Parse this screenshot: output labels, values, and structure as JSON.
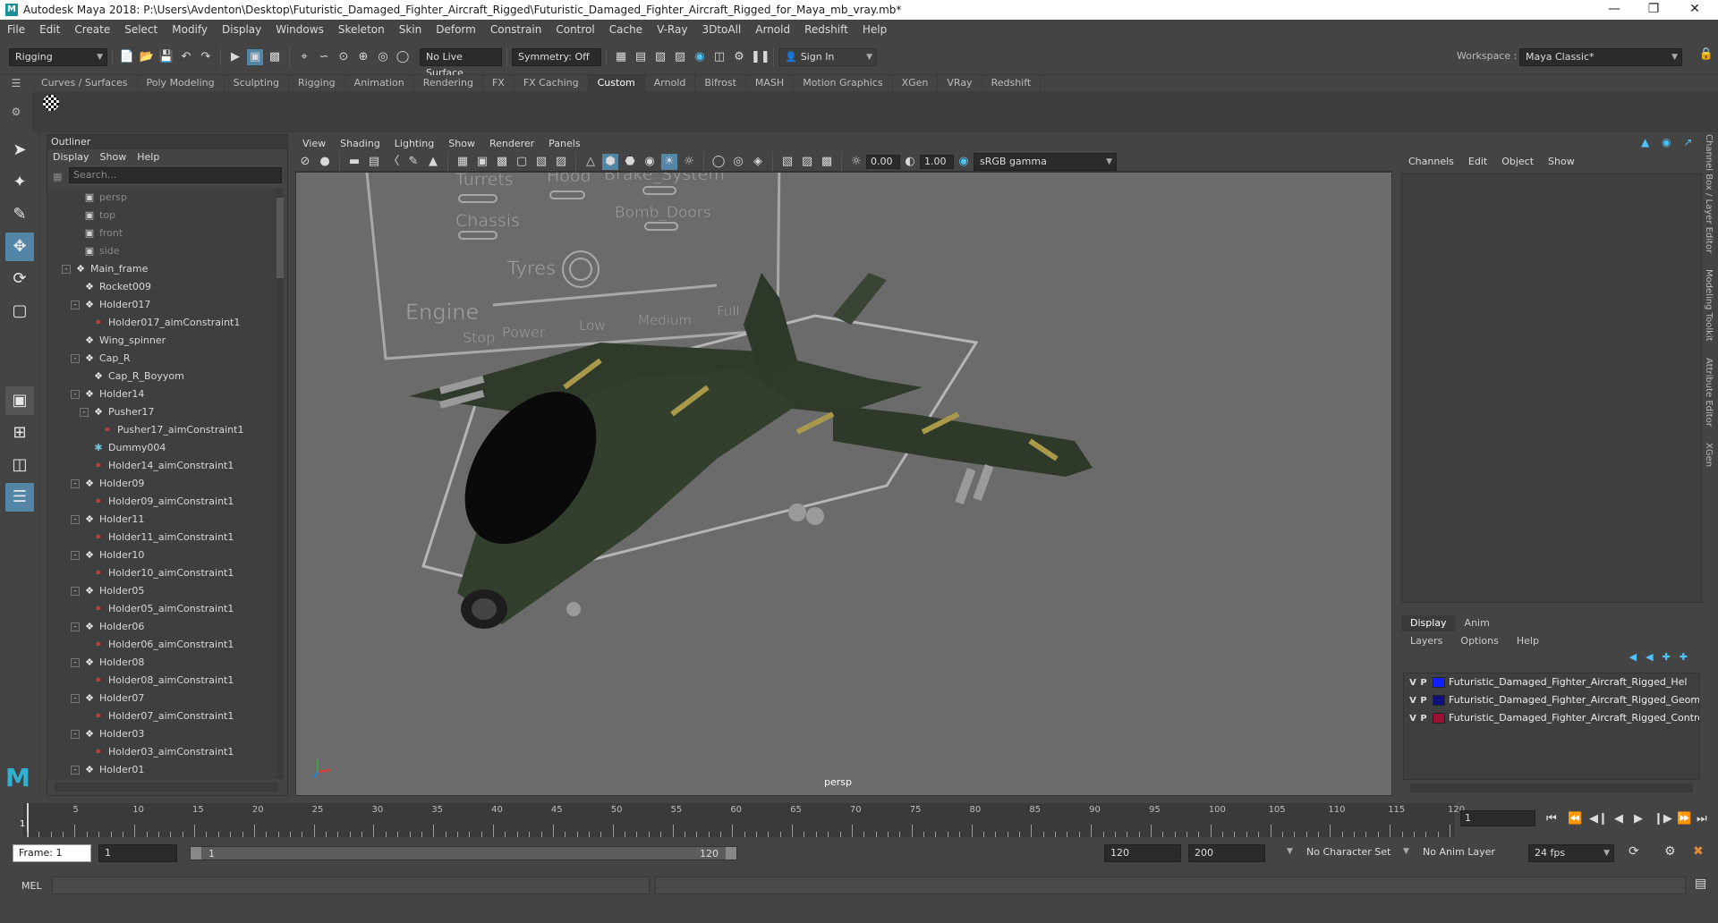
{
  "title": "Autodesk Maya 2018: P:\\Users\\Avdenton\\Desktop\\Futuristic_Damaged_Fighter_Aircraft_Rigged\\Futuristic_Damaged_Fighter_Aircraft_Rigged_for_Maya_mb_vray.mb*",
  "menu": [
    "File",
    "Edit",
    "Create",
    "Select",
    "Modify",
    "Display",
    "Windows",
    "Skeleton",
    "Skin",
    "Deform",
    "Constrain",
    "Control",
    "Cache",
    "V-Ray",
    "3DtoAll",
    "Arnold",
    "Redshift",
    "Help"
  ],
  "status": {
    "mode": "Rigging",
    "live_surface": "No Live Surface",
    "symmetry": "Symmetry: Off",
    "sign_in": "Sign In",
    "workspace_label": "Workspace :",
    "workspace_value": "Maya Classic*"
  },
  "shelf_tabs": [
    "Curves / Surfaces",
    "Poly Modeling",
    "Sculpting",
    "Rigging",
    "Animation",
    "Rendering",
    "FX",
    "FX Caching",
    "Custom",
    "Arnold",
    "Bifrost",
    "MASH",
    "Motion Graphics",
    "XGen",
    "VRay",
    "Redshift"
  ],
  "shelf_active": "Custom",
  "outliner": {
    "title": "Outliner",
    "menu": [
      "Display",
      "Show",
      "Help"
    ],
    "search_placeholder": "Search...",
    "items": [
      {
        "label": "persp",
        "type": "camera",
        "indent": 2,
        "dim": true
      },
      {
        "label": "top",
        "type": "camera",
        "indent": 2,
        "dim": true
      },
      {
        "label": "front",
        "type": "camera",
        "indent": 2,
        "dim": true
      },
      {
        "label": "side",
        "type": "camera",
        "indent": 2,
        "dim": true
      },
      {
        "label": "Main_frame",
        "type": "transform",
        "indent": 1,
        "expand": "-"
      },
      {
        "label": "Rocket009",
        "type": "transform",
        "indent": 2
      },
      {
        "label": "Holder017",
        "type": "transform",
        "indent": 2,
        "expand": "-"
      },
      {
        "label": "Holder017_aimConstraint1",
        "type": "constraint",
        "indent": 3
      },
      {
        "label": "Wing_spinner",
        "type": "transform",
        "indent": 2
      },
      {
        "label": "Cap_R",
        "type": "transform",
        "indent": 2,
        "expand": "-"
      },
      {
        "label": "Cap_R_Boyyom",
        "type": "transform",
        "indent": 3
      },
      {
        "label": "Holder14",
        "type": "transform",
        "indent": 2,
        "expand": "-"
      },
      {
        "label": "Pusher17",
        "type": "transform",
        "indent": 3,
        "expand": "-"
      },
      {
        "label": "Pusher17_aimConstraint1",
        "type": "constraint",
        "indent": 4
      },
      {
        "label": "Dummy004",
        "type": "dummy",
        "indent": 3
      },
      {
        "label": "Holder14_aimConstraint1",
        "type": "constraint",
        "indent": 3
      },
      {
        "label": "Holder09",
        "type": "transform",
        "indent": 2,
        "expand": "-"
      },
      {
        "label": "Holder09_aimConstraint1",
        "type": "constraint",
        "indent": 3
      },
      {
        "label": "Holder11",
        "type": "transform",
        "indent": 2,
        "expand": "-"
      },
      {
        "label": "Holder11_aimConstraint1",
        "type": "constraint",
        "indent": 3
      },
      {
        "label": "Holder10",
        "type": "transform",
        "indent": 2,
        "expand": "-"
      },
      {
        "label": "Holder10_aimConstraint1",
        "type": "constraint",
        "indent": 3
      },
      {
        "label": "Holder05",
        "type": "transform",
        "indent": 2,
        "expand": "-"
      },
      {
        "label": "Holder05_aimConstraint1",
        "type": "constraint",
        "indent": 3
      },
      {
        "label": "Holder06",
        "type": "transform",
        "indent": 2,
        "expand": "-"
      },
      {
        "label": "Holder06_aimConstraint1",
        "type": "constraint",
        "indent": 3
      },
      {
        "label": "Holder08",
        "type": "transform",
        "indent": 2,
        "expand": "-"
      },
      {
        "label": "Holder08_aimConstraint1",
        "type": "constraint",
        "indent": 3
      },
      {
        "label": "Holder07",
        "type": "transform",
        "indent": 2,
        "expand": "-"
      },
      {
        "label": "Holder07_aimConstraint1",
        "type": "constraint",
        "indent": 3
      },
      {
        "label": "Holder03",
        "type": "transform",
        "indent": 2,
        "expand": "-"
      },
      {
        "label": "Holder03_aimConstraint1",
        "type": "constraint",
        "indent": 3
      },
      {
        "label": "Holder01",
        "type": "transform",
        "indent": 2,
        "expand": "-"
      }
    ]
  },
  "viewport": {
    "menu": [
      "View",
      "Shading",
      "Lighting",
      "Show",
      "Renderer",
      "Panels"
    ],
    "value_a": "0.00",
    "value_b": "1.00",
    "color_space": "sRGB gamma",
    "camera": "persp",
    "hud_labels": {
      "turrets": "Turrets",
      "hood": "Hood",
      "brake": "Brake_System",
      "chassis": "Chassis",
      "bomb": "Bomb_Doors",
      "tyres": "Tyres",
      "engine": "Engine",
      "stop": "Stop",
      "power": "Power",
      "low": "Low",
      "medium": "Medium",
      "full": "Full"
    }
  },
  "channelbox": {
    "menu": [
      "Channels",
      "Edit",
      "Object",
      "Show"
    ]
  },
  "side_tabs": [
    "Channel Box / Layer Editor",
    "Modeling Toolkit",
    "Attribute Editor",
    "XGen"
  ],
  "layers": {
    "tabs": [
      "Display",
      "Anim"
    ],
    "active_tab": "Display",
    "menu": [
      "Layers",
      "Options",
      "Help"
    ],
    "rows": [
      {
        "v": "V",
        "p": "P",
        "color": "#1020ff",
        "name": "Futuristic_Damaged_Fighter_Aircraft_Rigged_Hel"
      },
      {
        "v": "V",
        "p": "P",
        "color": "#101080",
        "name": "Futuristic_Damaged_Fighter_Aircraft_Rigged_Geom"
      },
      {
        "v": "V",
        "p": "P",
        "color": "#9a1030",
        "name": "Futuristic_Damaged_Fighter_Aircraft_Rigged_Contro"
      }
    ]
  },
  "timeline": {
    "start": 1,
    "end": 120,
    "current": 1,
    "current_field": "1",
    "ticks": [
      5,
      10,
      15,
      20,
      25,
      30,
      35,
      40,
      45,
      50,
      55,
      60,
      65,
      70,
      75,
      80,
      85,
      90,
      95,
      100,
      105,
      110,
      115,
      120
    ]
  },
  "range": {
    "frame_label": "Frame: 1",
    "start_field": "1",
    "range_start": "1",
    "range_end": "120",
    "anim_end": "120",
    "max_end": "200",
    "character_set": "No Character Set",
    "anim_layer": "No Anim Layer",
    "fps": "24 fps"
  },
  "cmd": {
    "lang": "MEL"
  }
}
